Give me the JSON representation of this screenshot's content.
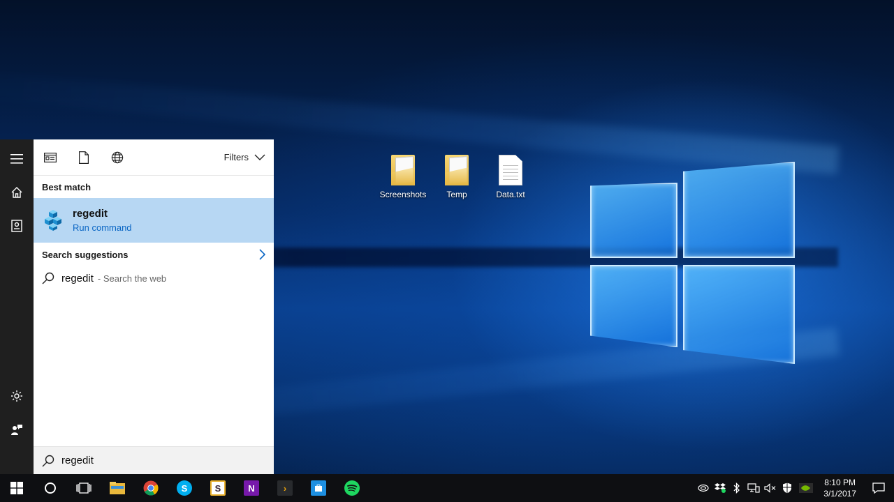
{
  "desktop": {
    "icons": [
      {
        "label": "Screenshots",
        "type": "folder"
      },
      {
        "label": "Temp",
        "type": "folder"
      },
      {
        "label": "Data.txt",
        "type": "file"
      }
    ]
  },
  "start_rail": {
    "items": [
      {
        "name": "hamburger-menu-icon"
      },
      {
        "name": "home-icon"
      },
      {
        "name": "notebook-icon"
      },
      {
        "name": "settings-gear-icon"
      },
      {
        "name": "feedback-icon"
      }
    ]
  },
  "search_panel": {
    "header": {
      "filter_icons": [
        "apps-filter-icon",
        "documents-filter-icon",
        "web-filter-icon"
      ],
      "filters_label": "Filters"
    },
    "best_match_label": "Best match",
    "best_match": {
      "title": "regedit",
      "subtitle": "Run command",
      "icon": "regedit-cubes-icon"
    },
    "suggestions_label": "Search suggestions",
    "suggestions": [
      {
        "query": "regedit",
        "suffix": "- Search the web"
      }
    ],
    "search_box": {
      "value": "regedit"
    }
  },
  "taskbar": {
    "pinned": [
      "start-icon",
      "cortana-icon",
      "task-view-icon",
      "file-explorer-icon",
      "chrome-icon",
      "skype-icon",
      "slack-icon",
      "onenote-icon",
      "plex-icon",
      "store-icon",
      "spotify-icon"
    ],
    "clock": {
      "time": "8:10 PM",
      "date": "3/1/2017"
    }
  },
  "colors": {
    "accent": "#0a66c4",
    "best_match_bg": "#b7d7f3",
    "rail_bg": "#1f1f1f",
    "taskbar_bg": "#0e0f12"
  }
}
